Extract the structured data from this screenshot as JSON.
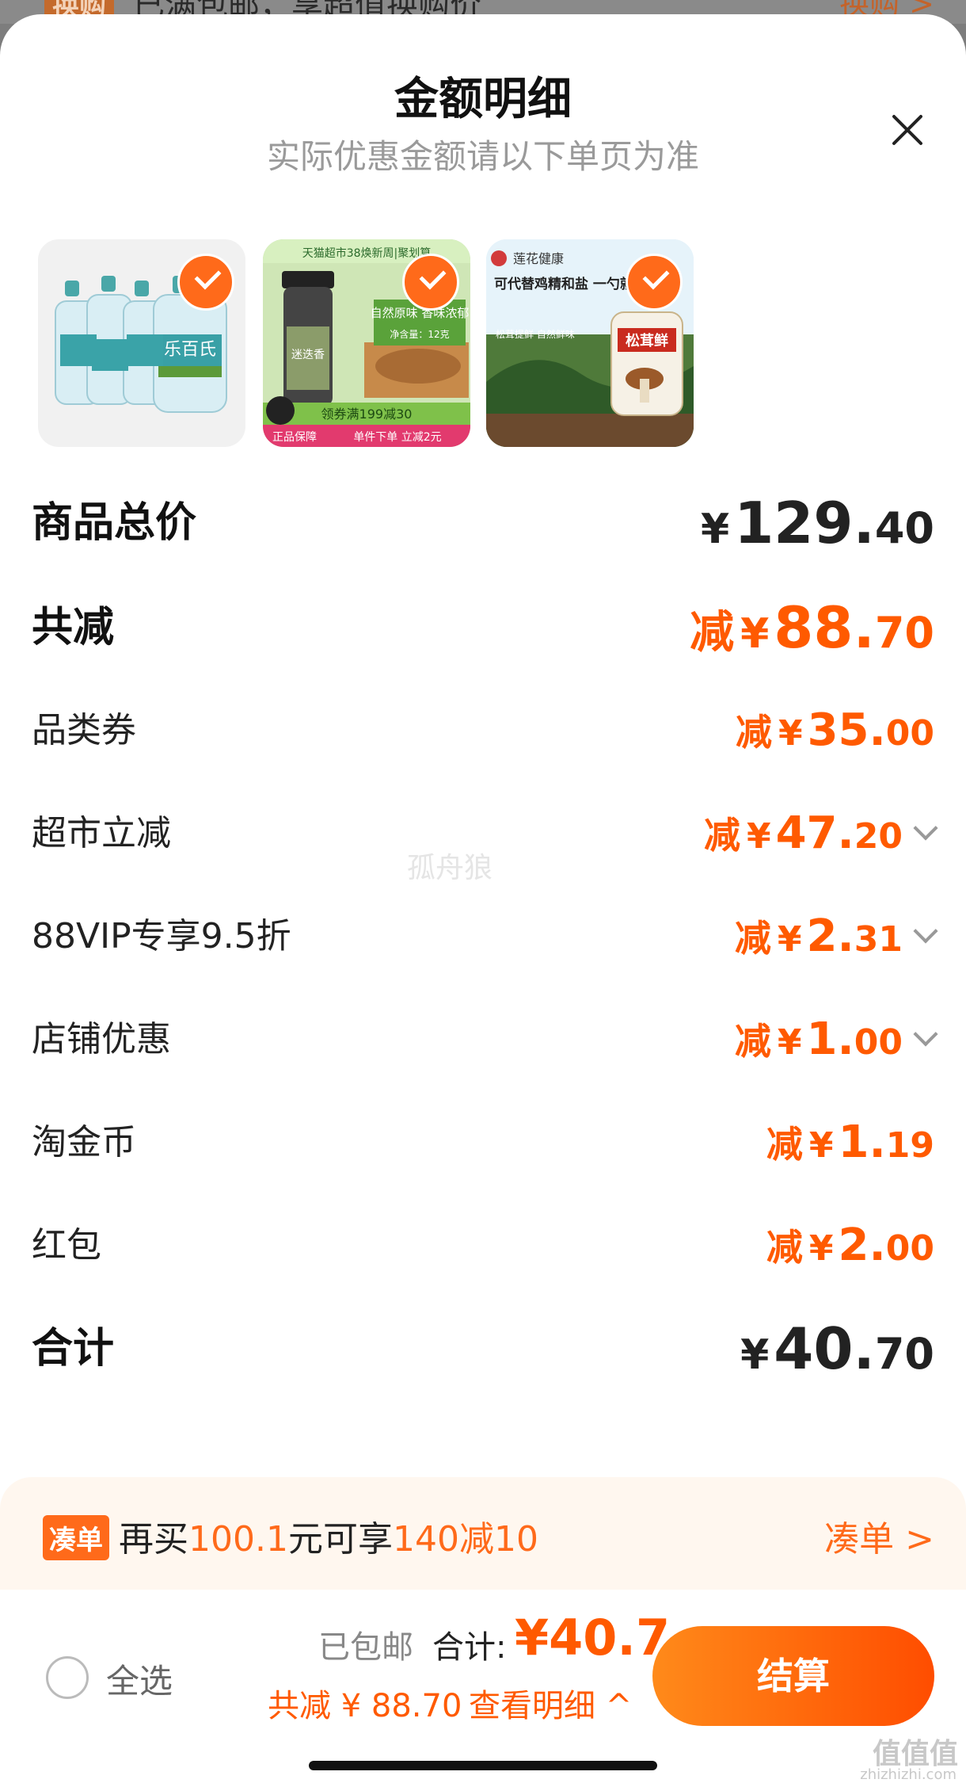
{
  "top_strip": {
    "tag": "换购",
    "text": "已满包邮，享超值换购价",
    "link": "换购 >"
  },
  "header": {
    "title": "金额明细",
    "subtitle": "实际优惠金额请以下单页为准"
  },
  "products": [
    {
      "name": "water-bottles-product",
      "label_1": "乐百氏",
      "selected": true
    },
    {
      "name": "seasoning-product",
      "banner": "天猫超市38焕新周|聚划算",
      "label_1": "迷迭香",
      "label_2": "自然原味 香味浓郁",
      "label_3": "净含量：12克",
      "promo": "领券满199减30",
      "badge": "正品保障",
      "promo2": "单件下单 立减2元",
      "selected": true
    },
    {
      "name": "mushroom-salt-product",
      "brand": "莲花健康",
      "headline": "可代替鸡精和盐 一勺就鲜",
      "sub": "松茸提鲜 自然鲜味",
      "product_name": "松茸鲜",
      "selected": true
    }
  ],
  "rows": [
    {
      "label": "商品总价",
      "minus": "",
      "currency": "¥",
      "int": "129.",
      "dec": "40",
      "style": "big dark",
      "chevron": false
    },
    {
      "label": "共减",
      "minus": "减",
      "currency": "¥",
      "int": "88.",
      "dec": "70",
      "style": "big",
      "chevron": false
    },
    {
      "label": "品类券",
      "minus": "减",
      "currency": "¥",
      "int": "35.",
      "dec": "00",
      "style": "",
      "chevron": false
    },
    {
      "label": "超市立减",
      "minus": "减",
      "currency": "¥",
      "int": "47.",
      "dec": "20",
      "style": "",
      "chevron": true
    },
    {
      "label": "88VIP专享9.5折",
      "minus": "减",
      "currency": "¥",
      "int": "2.",
      "dec": "31",
      "style": "",
      "chevron": true
    },
    {
      "label": "店铺优惠",
      "minus": "减",
      "currency": "¥",
      "int": "1.",
      "dec": "00",
      "style": "",
      "chevron": true
    },
    {
      "label": "淘金币",
      "minus": "减",
      "currency": "¥",
      "int": "1.",
      "dec": "19",
      "style": "",
      "chevron": false
    },
    {
      "label": "红包",
      "minus": "减",
      "currency": "¥",
      "int": "2.",
      "dec": "00",
      "style": "",
      "chevron": false
    },
    {
      "label": "合计",
      "minus": "",
      "currency": "¥",
      "int": "40.",
      "dec": "70",
      "style": "big dark",
      "chevron": false
    }
  ],
  "watermark": "孤舟狼",
  "addon": {
    "tag": "凑单",
    "pre": "再买",
    "amount": "100.1",
    "mid": "元可享",
    "deal": "140减10",
    "button": "凑单 >"
  },
  "footer": {
    "select_all": "全选",
    "shipping": "已包邮",
    "total_label": "合计:",
    "total_value": "¥40.7",
    "saved": "共减 ¥ 88.70",
    "detail": "查看明细 ^",
    "checkout": "结算"
  },
  "corner_logo": "值值值",
  "corner_url": "zhizhizhi.com",
  "colors": {
    "accent": "#ff5a00",
    "text": "#222222",
    "muted": "#9a9a9a"
  }
}
